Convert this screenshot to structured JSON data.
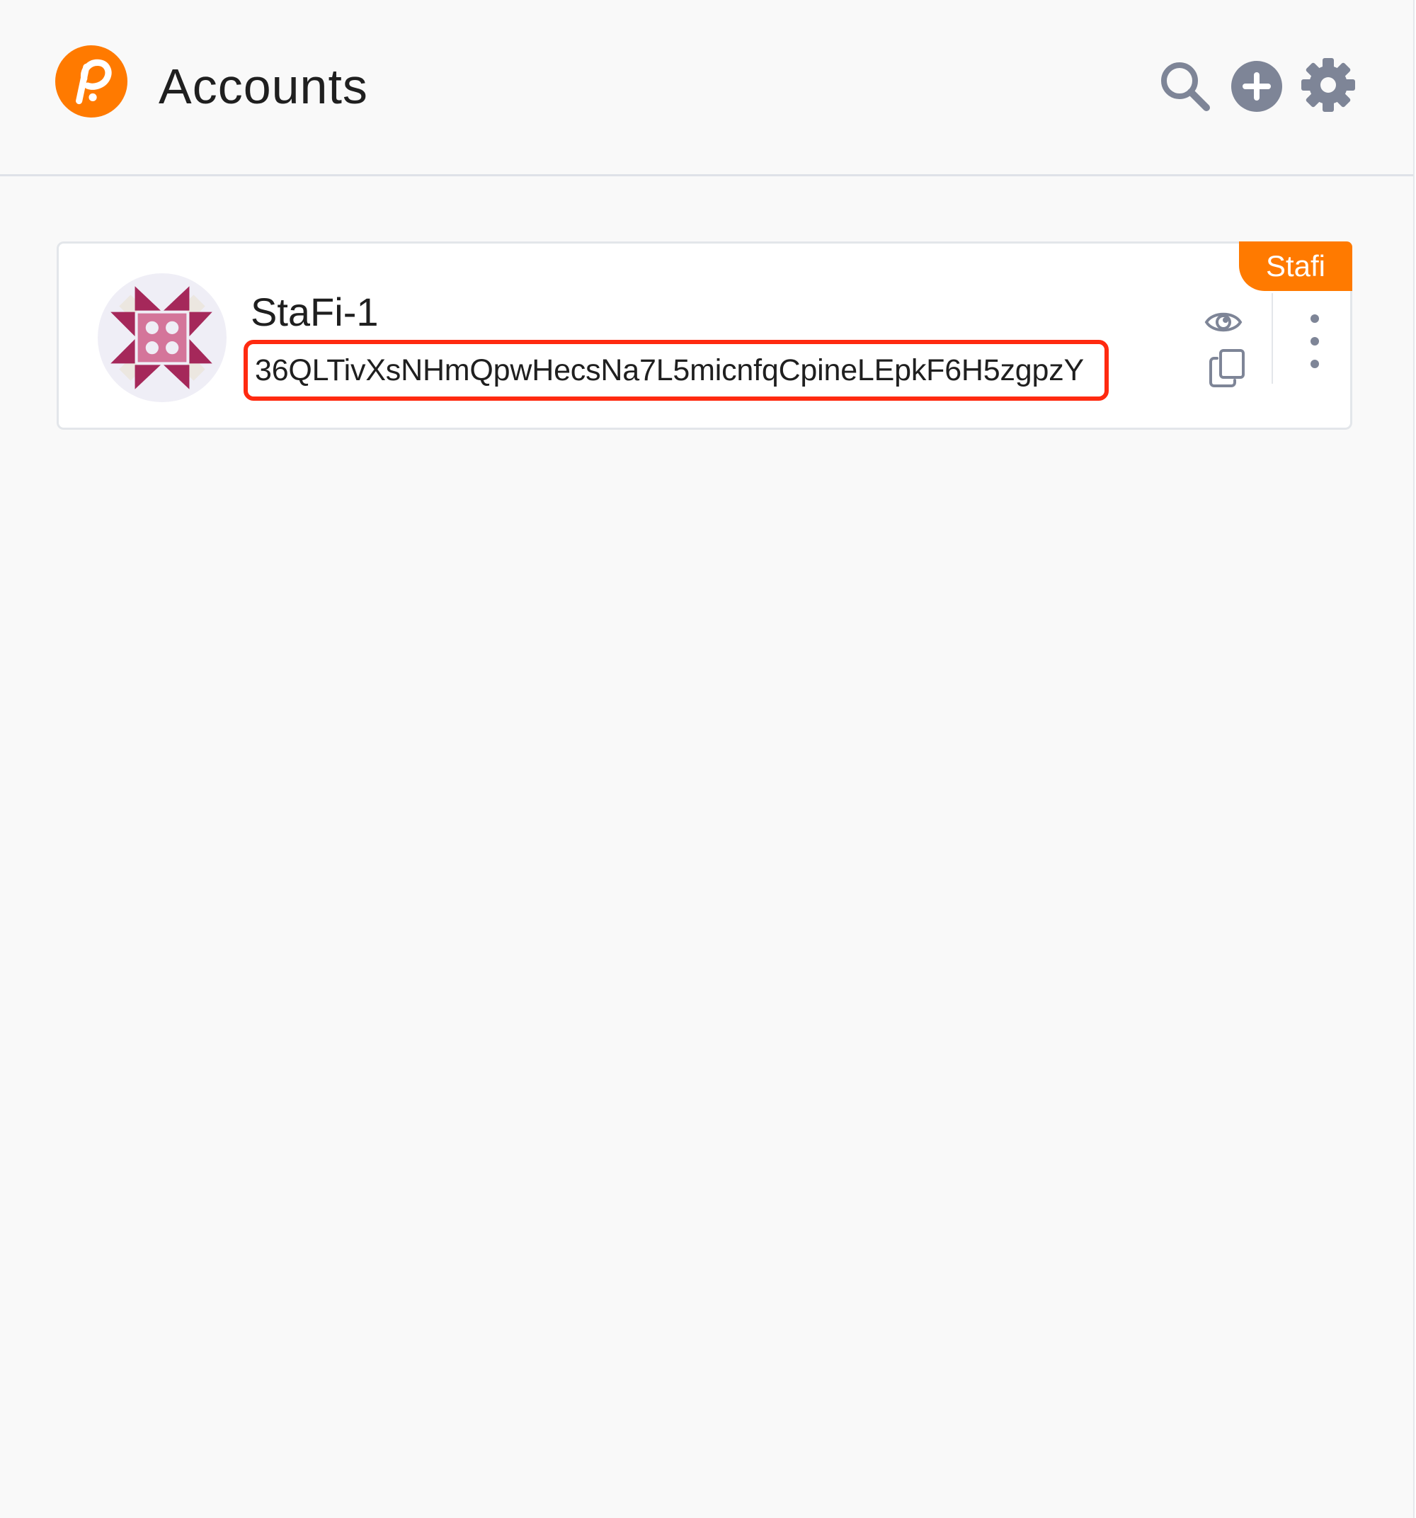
{
  "header": {
    "title": "Accounts",
    "logo_icon": "polkadot-p-logo",
    "actions": {
      "search_icon": "search-icon",
      "add_icon": "plus-circle-icon",
      "settings_icon": "gear-icon"
    }
  },
  "accounts": [
    {
      "name": "StaFi-1",
      "address": "36QLTivXsNHmQpwHecsNa7L5micnfqCpineLEpkF6H5zgpzY",
      "network_badge": "Stafi",
      "avatar_icon": "identicon",
      "actions": {
        "visibility_icon": "eye-icon",
        "copy_icon": "copy-icon",
        "menu_icon": "more-vertical-icon"
      }
    }
  ],
  "colors": {
    "accent": "#ff7a00",
    "highlight": "#ff2a10",
    "icon_gray": "#7e8597",
    "background": "#f9f9f9"
  }
}
